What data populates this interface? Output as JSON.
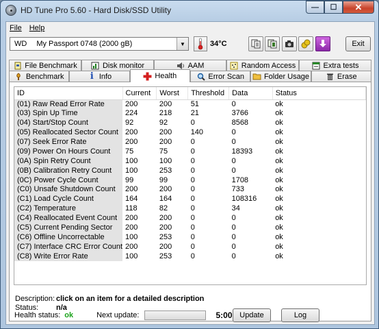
{
  "window": {
    "title": "HD Tune Pro 5.60 - Hard Disk/SSD Utility",
    "min": "—",
    "max": "☐",
    "close": "✕"
  },
  "menu": {
    "file": "File",
    "help": "Help"
  },
  "toolbar": {
    "drive_prefix": "WD",
    "drive_name": "My Passport 0748 (2000 gB)",
    "temperature": "34°C",
    "exit_label": "Exit"
  },
  "tabs_top": [
    {
      "label": "File Benchmark",
      "icon": "file-benchmark-icon"
    },
    {
      "label": "Disk monitor",
      "icon": "disk-monitor-icon"
    },
    {
      "label": "AAM",
      "icon": "speaker-icon"
    },
    {
      "label": "Random Access",
      "icon": "random-access-icon"
    },
    {
      "label": "Extra tests",
      "icon": "extra-tests-icon"
    }
  ],
  "tabs_bottom": [
    {
      "label": "Benchmark",
      "icon": "benchmark-icon"
    },
    {
      "label": "Info",
      "icon": "info-icon"
    },
    {
      "label": "Health",
      "icon": "health-cross-icon",
      "active": true
    },
    {
      "label": "Error Scan",
      "icon": "magnifier-icon"
    },
    {
      "label": "Folder Usage",
      "icon": "folder-icon"
    },
    {
      "label": "Erase",
      "icon": "trash-icon"
    }
  ],
  "table": {
    "headers": [
      "ID",
      "Current",
      "Worst",
      "Threshold",
      "Data",
      "Status"
    ],
    "rows": [
      [
        "(01) Raw Read Error Rate",
        "200",
        "200",
        "51",
        "0",
        "ok"
      ],
      [
        "(03) Spin Up Time",
        "224",
        "218",
        "21",
        "3766",
        "ok"
      ],
      [
        "(04) Start/Stop Count",
        "92",
        "92",
        "0",
        "8568",
        "ok"
      ],
      [
        "(05) Reallocated Sector Count",
        "200",
        "200",
        "140",
        "0",
        "ok"
      ],
      [
        "(07) Seek Error Rate",
        "200",
        "200",
        "0",
        "0",
        "ok"
      ],
      [
        "(09) Power On Hours Count",
        "75",
        "75",
        "0",
        "18393",
        "ok"
      ],
      [
        "(0A) Spin Retry Count",
        "100",
        "100",
        "0",
        "0",
        "ok"
      ],
      [
        "(0B) Calibration Retry Count",
        "100",
        "253",
        "0",
        "0",
        "ok"
      ],
      [
        "(0C) Power Cycle Count",
        "99",
        "99",
        "0",
        "1708",
        "ok"
      ],
      [
        "(C0) Unsafe Shutdown Count",
        "200",
        "200",
        "0",
        "733",
        "ok"
      ],
      [
        "(C1) Load Cycle Count",
        "164",
        "164",
        "0",
        "108316",
        "ok"
      ],
      [
        "(C2) Temperature",
        "118",
        "82",
        "0",
        "34",
        "ok"
      ],
      [
        "(C4) Reallocated Event Count",
        "200",
        "200",
        "0",
        "0",
        "ok"
      ],
      [
        "(C5) Current Pending Sector",
        "200",
        "200",
        "0",
        "0",
        "ok"
      ],
      [
        "(C6) Offline Uncorrectable",
        "100",
        "253",
        "0",
        "0",
        "ok"
      ],
      [
        "(C7) Interface CRC Error Count",
        "200",
        "200",
        "0",
        "0",
        "ok"
      ],
      [
        "(C8) Write Error Rate",
        "100",
        "253",
        "0",
        "0",
        "ok"
      ]
    ]
  },
  "description": {
    "desc_label": "Description:",
    "desc_value": "click on an item for a detailed description",
    "status_label": "Status:",
    "status_value": "n/a"
  },
  "status": {
    "health_label": "Health status:",
    "health_value": "ok",
    "next_update_label": "Next update:",
    "next_update_progress": 0,
    "timer": "5:00",
    "update_label": "Update",
    "log_label": "Log"
  },
  "colors": {
    "health_ok": "#1aa31a",
    "close_button": "#c8432b"
  }
}
